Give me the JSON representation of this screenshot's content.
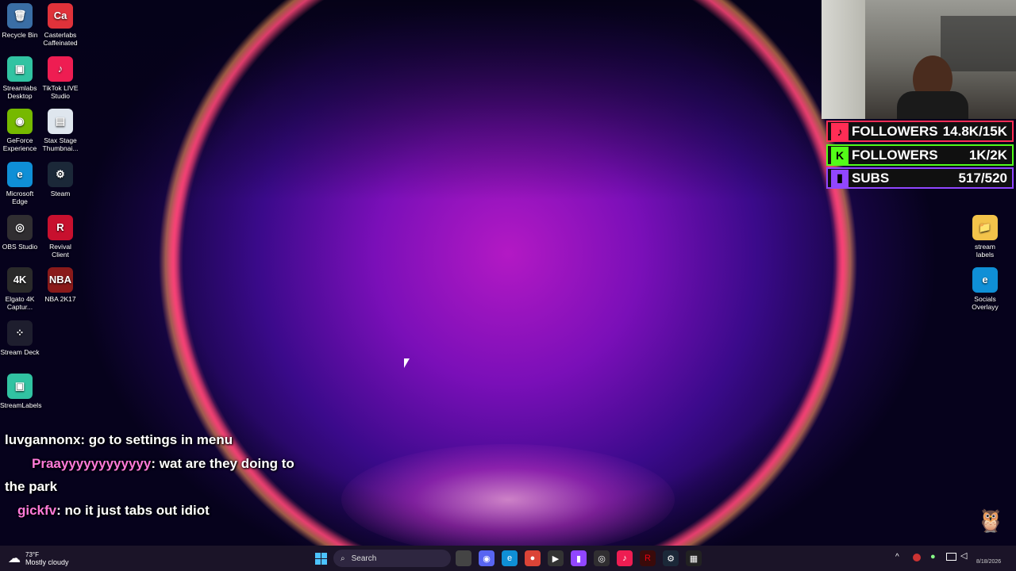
{
  "desktop_icons": [
    {
      "label": "Recycle Bin",
      "glyph": "🗑",
      "color": "#3a6ea5"
    },
    {
      "label": "Casterlabs Caffeinated",
      "glyph": "Ca",
      "color": "#e0323a"
    },
    {
      "label": "Streamlabs Desktop",
      "glyph": "▣",
      "color": "#31c3a2"
    },
    {
      "label": "TikTok LIVE Studio",
      "glyph": "♪",
      "color": "#ee1d52"
    },
    {
      "label": "GeForce Experience",
      "glyph": "◉",
      "color": "#76b900"
    },
    {
      "label": "Stax Stage Thumbnai...",
      "glyph": "▤",
      "color": "#dfe6ee"
    },
    {
      "label": "Microsoft Edge",
      "glyph": "e",
      "color": "#0f8fd6"
    },
    {
      "label": "Steam",
      "glyph": "⚙",
      "color": "#1b2838"
    },
    {
      "label": "OBS Studio",
      "glyph": "◎",
      "color": "#302e31"
    },
    {
      "label": "Revival Client",
      "glyph": "R",
      "color": "#c8102e"
    },
    {
      "label": "Elgato 4K Captur...",
      "glyph": "4K",
      "color": "#2a2a2a"
    },
    {
      "label": "NBA 2K17",
      "glyph": "NBA",
      "color": "#8a1a1a"
    },
    {
      "label": "Stream Deck",
      "glyph": "⁘",
      "color": "#1e1e2e"
    },
    {
      "label": "StreamLabels",
      "glyph": "▣",
      "color": "#31c3a2"
    },
    {
      "label": "stream labels",
      "glyph": "📁",
      "color": "#f3c34a"
    },
    {
      "label": "Socials Overlayy",
      "glyph": "e",
      "color": "#0f8fd6"
    }
  ],
  "chat": [
    {
      "user": "luvgannonx",
      "text": "go to settings in menu"
    },
    {
      "user": "Praayyyyyyyyyyyy",
      "text": "wat are they doing to"
    },
    {
      "user": "",
      "text": "the park"
    },
    {
      "user": "gickfv",
      "text": "no it just tabs out idiot"
    }
  ],
  "stats": [
    {
      "label": "FOLLOWERS",
      "value": "14.8K/15K",
      "color": "#ff2d55",
      "glyph": "♪"
    },
    {
      "label": "FOLLOWERS",
      "value": "1K/2K",
      "color": "#53fc18",
      "glyph": "K"
    },
    {
      "label": "SUBS",
      "value": "517/520",
      "color": "#9146ff",
      "glyph": "▮"
    }
  ],
  "taskbar": {
    "weather_temp": "73°F",
    "weather_desc": "Mostly cloudy",
    "search_placeholder": "Search",
    "clock": "8/18/2026"
  }
}
